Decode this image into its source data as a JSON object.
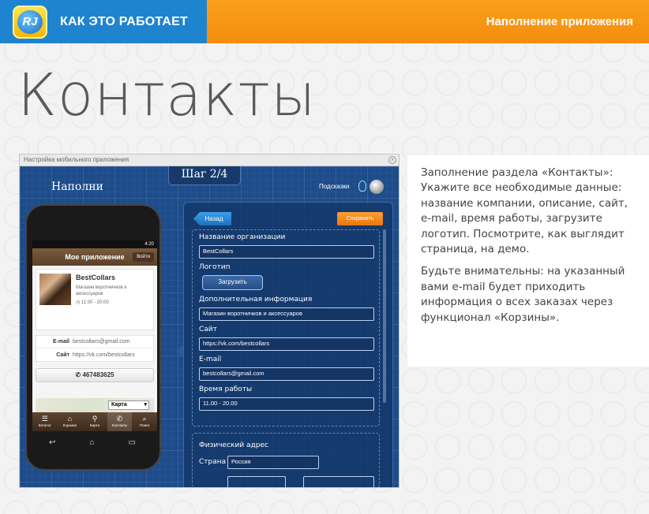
{
  "header": {
    "logo_text": "RJ",
    "section_title": "КАК ЭТО РАБОТАЕТ",
    "page_subtitle": "Наполнение приложения"
  },
  "heading": "Контакты",
  "screenshot": {
    "window_title": "Настройка мобильного приложения",
    "step_label": "Шаг 2/4",
    "panel_title": "Наполни",
    "hints_label": "Подсказки",
    "phone": {
      "status_time": "4:20",
      "app_title": "Мое приложение",
      "login_label": "Войти",
      "company_name": "BestCollars",
      "company_description": "Магазин воротничков и аксессуаров",
      "hours": "◷ 11:00 - 20:00",
      "contacts": [
        {
          "label": "E-mail",
          "value": "bestcollars@gmail.com"
        },
        {
          "label": "Сайт",
          "value": "https://vk.com/bestcollars"
        }
      ],
      "phone_number": "✆ 467483625",
      "map_select": "Карта",
      "tabs": [
        {
          "icon": "☰",
          "label": "Каталог"
        },
        {
          "icon": "⌂",
          "label": "Корзина"
        },
        {
          "icon": "⚲",
          "label": "Карта"
        },
        {
          "icon": "✆",
          "label": "Контакты"
        },
        {
          "icon": "⌕",
          "label": "Поиск"
        }
      ]
    },
    "form": {
      "back_label": "Назад",
      "save_label": "Сохранить",
      "org_name_label": "Название организации",
      "org_name_value": "BestCollars",
      "logo_label": "Логотип",
      "upload_label": "Загрузить",
      "extra_info_label": "Дополнительная информация",
      "extra_info_value": "Магазин воротничков и аксессуаров",
      "site_label": "Сайт",
      "site_value": "https://vk.com/bestcollars",
      "email_label": "E-mail",
      "email_value": "bestcollars@gmail.com",
      "hours_label": "Время работы",
      "hours_value": "11.00 - 20.00",
      "address_label": "Физический адрес",
      "country_label": "Страна",
      "country_value": "Россия"
    }
  },
  "description": {
    "paragraph1": "Заполнение раздела «Контакты»: Укажите все необходимые данные: название компании, описание, сайт, e-mail, время работы, загрузите логотип. Посмотрите, как выглядит страница, на демо.",
    "paragraph2": "Будьте внимательны: на указанный вами e-mail будет приходить информация о всех заказах через функционал «Корзины»."
  },
  "colors": {
    "header_blue": "#1f84d0",
    "header_orange": "#f7961a",
    "blueprint_bg": "#1e4c8a"
  }
}
